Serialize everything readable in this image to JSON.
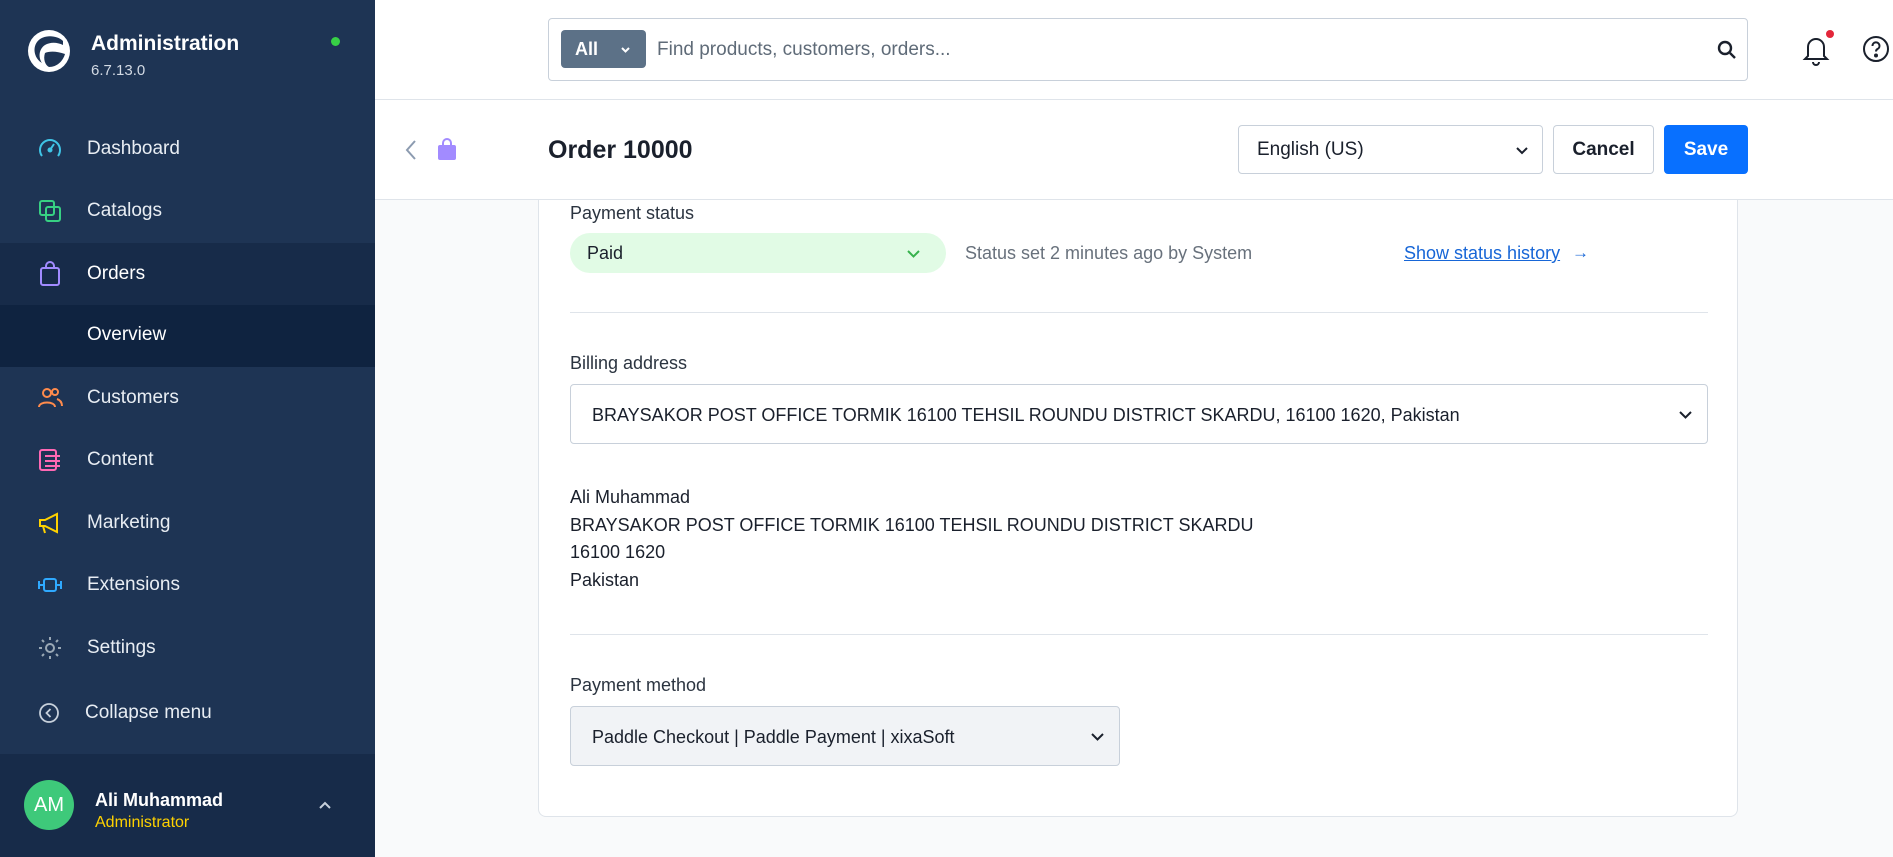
{
  "brand": {
    "title": "Administration",
    "version": "6.7.13.0",
    "status_color": "#37d046"
  },
  "nav": {
    "items": [
      {
        "label": "Dashboard",
        "icon": "dashboard-icon",
        "color": "#3fc4e6"
      },
      {
        "label": "Catalogs",
        "icon": "catalogs-icon",
        "color": "#37d083"
      },
      {
        "label": "Orders",
        "icon": "orders-icon",
        "color": "#a28bff"
      },
      {
        "label": "Customers",
        "icon": "customers-icon",
        "color": "#ff8b4c"
      },
      {
        "label": "Content",
        "icon": "content-icon",
        "color": "#ff68b4"
      },
      {
        "label": "Marketing",
        "icon": "marketing-icon",
        "color": "#ffd200"
      },
      {
        "label": "Extensions",
        "icon": "extensions-icon",
        "color": "#2fa9ff"
      },
      {
        "label": "Settings",
        "icon": "settings-icon",
        "color": "#9aa8b5"
      }
    ],
    "sub_item": "Overview",
    "collapse_label": "Collapse menu"
  },
  "user": {
    "initials": "AM",
    "name": "Ali Muhammad",
    "role": "Administrator"
  },
  "search": {
    "type_label": "All",
    "placeholder": "Find products, customers, orders..."
  },
  "header": {
    "title": "Order 10000",
    "language": "English (US)",
    "cancel_label": "Cancel",
    "save_label": "Save"
  },
  "order": {
    "payment_status_label": "Payment status",
    "payment_status_value": "Paid",
    "status_meta": "Status set 2 minutes ago by System",
    "status_history_link": "Show status history",
    "billing_label": "Billing address",
    "billing_selected": "BRAYSAKOR POST OFFICE TORMIK 16100 TEHSIL ROUNDU DISTRICT SKARDU, 16100 1620, Pakistan",
    "address_lines": [
      "Ali Muhammad",
      "BRAYSAKOR POST OFFICE TORMIK 16100 TEHSIL ROUNDU DISTRICT SKARDU",
      "16100 1620",
      "Pakistan"
    ],
    "payment_method_label": "Payment method",
    "payment_method_value": "Paddle Checkout | Paddle Payment | xixaSoft"
  }
}
